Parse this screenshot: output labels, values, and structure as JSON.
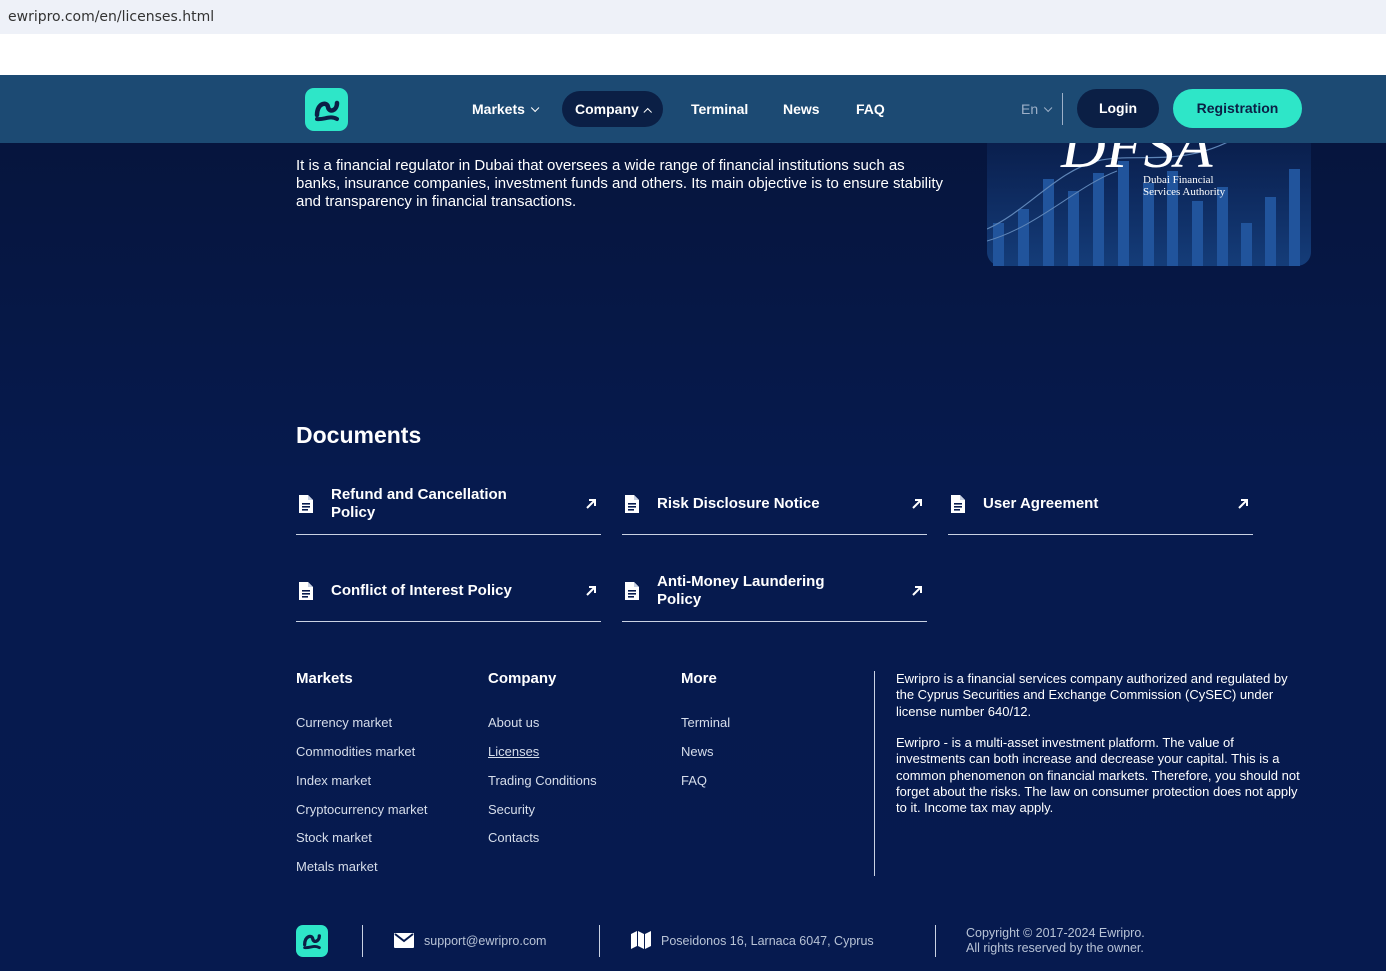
{
  "browser": {
    "url": "ewripro.com/en/licenses.html"
  },
  "header": {
    "nav": [
      {
        "label": "Markets",
        "dropdown": true
      },
      {
        "label": "Company",
        "dropdown": true,
        "active": true
      },
      {
        "label": "Terminal"
      },
      {
        "label": "News"
      },
      {
        "label": "FAQ"
      }
    ],
    "language": "En",
    "login_label": "Login",
    "register_label": "Registration"
  },
  "regulator": {
    "text": "It is a financial regulator in Dubai that oversees a wide range of financial institutions such as banks, insurance companies, investment funds and others. Its main objective is to ensure stability and transparency in financial transactions.",
    "logo_caption_line1": "Dubai Financial",
    "logo_caption_line2": "Services Authority",
    "logo_letters": "DFSA"
  },
  "documents": {
    "title": "Documents",
    "items": [
      {
        "label": "Refund and Cancellation Policy"
      },
      {
        "label": "Risk Disclosure Notice"
      },
      {
        "label": "User Agreement"
      },
      {
        "label": "Conflict of Interest Policy"
      },
      {
        "label": "Anti-Money Laundering Policy"
      }
    ]
  },
  "footer": {
    "columns": [
      {
        "title": "Markets",
        "links": [
          "Currency market",
          "Commodities market",
          "Index market",
          "Cryptocurrency market",
          "Stock market",
          "Metals market"
        ]
      },
      {
        "title": "Company",
        "links": [
          "About us",
          "Licenses",
          "Trading Conditions",
          "Security",
          "Contacts"
        ]
      },
      {
        "title": "More",
        "links": [
          "Terminal",
          "News",
          "FAQ"
        ]
      }
    ],
    "about_paragraph_1": "Ewripro is a financial services company authorized and regulated by the Cyprus Securities and Exchange Commission (CySEC) under license number 640/12.",
    "about_paragraph_2": "Ewripro - is a multi-asset investment platform. The value of investments can both increase and decrease your capital. This is a common phenomenon on financial markets. Therefore, you should not forget about the risks. The law on consumer protection does not apply to it. Income tax may apply.",
    "email": "support@ewripro.com",
    "address": "Poseidonos 16, Larnaca 6047, Cyprus",
    "copyright_line1": "Copyright © 2017-2024 Ewripro.",
    "copyright_line2": "All rights reserved by the owner."
  },
  "colors": {
    "accent": "#2ee6c8",
    "header_bg": "#1c4a73",
    "page_bg": "#061a4e",
    "button_dark": "#0b1f45"
  }
}
